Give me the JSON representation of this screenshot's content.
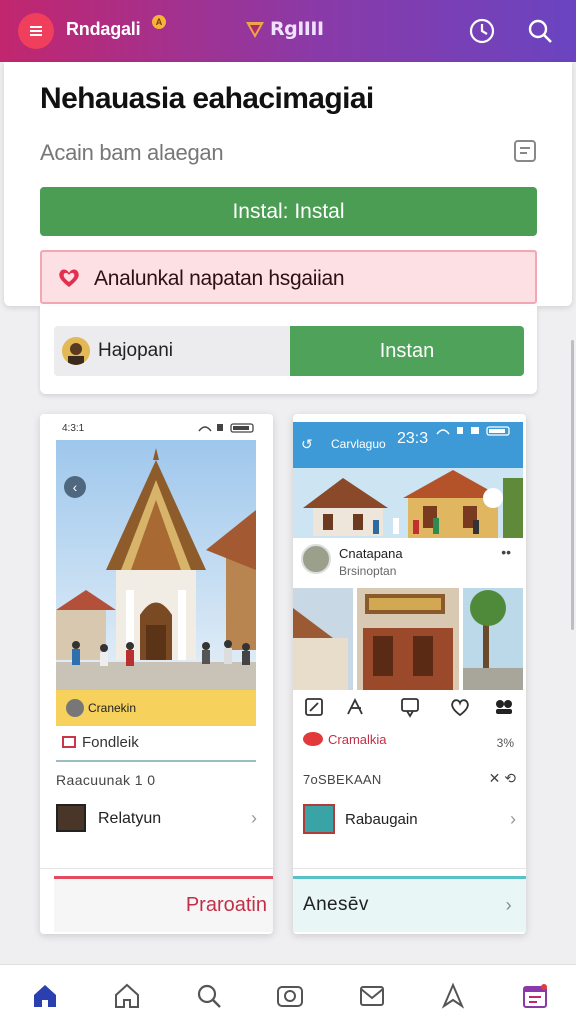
{
  "topbar": {
    "app_name": "Rndagali",
    "badge": "A",
    "logo_text": "RgIIII",
    "icons": [
      "menu-icon",
      "refresh-icon",
      "search-icon"
    ]
  },
  "install": {
    "title": "Nehauasia eahacimagiai",
    "subtitle": "Acain bam alaegan",
    "button_label": "Instal: Instal",
    "alert_text": "Analunkal napatan hsgaiian",
    "choice_left_label": "Hajopani",
    "choice_right_label": "Instan"
  },
  "left_preview": {
    "status_time": "4:3:1",
    "strip_label": "Cranekin",
    "tag_label": "Fondleik",
    "section_label": "Raacuunak 1 0",
    "list_item_label": "Relatyun",
    "cta_label": "Praroatin"
  },
  "right_preview": {
    "status_time": "23:3",
    "appbar_title": "Carvlaguo",
    "post_name": "Cnatapana",
    "post_sub": "Brsinoptan",
    "post_more": "••",
    "tag_label": "Cramalkia",
    "tag_count": "3%",
    "section_label": "7oSBEKAAN",
    "list_item_label": "Rabaugain",
    "cta_label": "Anesēv"
  },
  "bottom_nav": {
    "items": [
      "home-filled-icon",
      "home-icon",
      "search-icon",
      "camera-icon",
      "mail-icon",
      "send-icon",
      "calendar-icon"
    ],
    "accent": "#2a3fb0"
  },
  "colors": {
    "primary_green": "#4a9d52",
    "alert_bg": "#fde0e3",
    "topbar_start": "#c2266e",
    "topbar_end": "#6a44c0"
  }
}
